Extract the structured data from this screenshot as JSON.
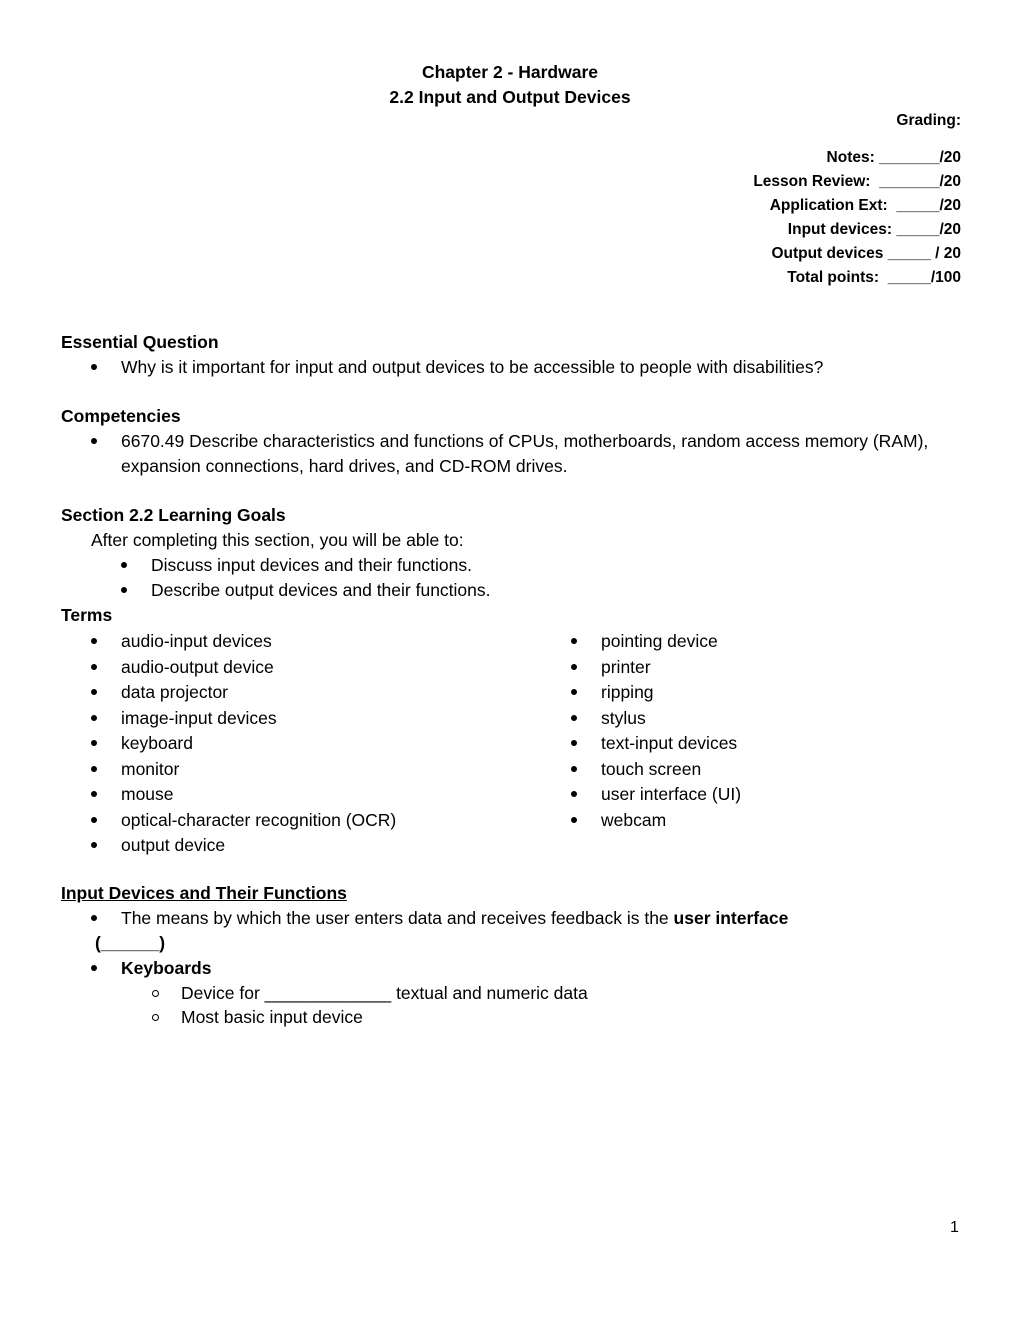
{
  "header": {
    "chapter_title": "Chapter 2 - Hardware",
    "section_title": "2.2 Input and Output Devices"
  },
  "grading": {
    "label": "Grading:",
    "rows": [
      {
        "label": "Notes:",
        "blank": "_______",
        "max": "/20"
      },
      {
        "label": "Lesson Review:",
        "blank": "_______",
        "max": "/20"
      },
      {
        "label": "Application Ext:",
        "blank": "_____",
        "max": "/20"
      },
      {
        "label": "Input devices:",
        "blank": "_____",
        "max": "/20"
      },
      {
        "label": "Output devices",
        "blank": "_____",
        "max": "/ 20"
      },
      {
        "label": "Total points:",
        "blank": "_____",
        "max": "/100"
      }
    ]
  },
  "essential_question": {
    "heading": "Essential Question",
    "items": [
      "Why is it important for input and output devices to be accessible to people with disabilities?"
    ]
  },
  "competencies": {
    "heading": "Competencies",
    "items": [
      {
        "line1": "6670.49 Describe characteristics and functions of CPUs, motherboards, random access memory (RAM),",
        "line2": "expansion connections, hard drives, and CD-ROM drives."
      }
    ]
  },
  "learning_goals": {
    "heading": "Section 2.2 Learning Goals",
    "intro": "After completing this section, you will be able to:",
    "items": [
      "Discuss input devices and their functions.",
      "Describe output devices and their functions."
    ]
  },
  "terms": {
    "heading": "Terms",
    "left": [
      "audio-input devices",
      "audio-output device",
      "data projector",
      "image-input devices",
      "keyboard",
      "monitor",
      "mouse",
      "optical-character recognition (OCR)",
      "output device"
    ],
    "right": [
      "pointing device",
      "printer",
      "ripping",
      "stylus",
      "text-input devices",
      "touch screen",
      "user interface (UI)",
      "webcam"
    ]
  },
  "input_devices": {
    "heading": "Input Devices and Their Functions",
    "ui_item": {
      "text": "The means by which the user enters data and receives feedback is the",
      "bold": "user interface",
      "blank_line": "(______)"
    },
    "keyboards": {
      "label": "Keyboards",
      "sub_items": [
        {
          "before": "Device for",
          "blank": "_____________",
          "after": "textual and numeric data"
        },
        {
          "text": "Most basic input device"
        }
      ]
    }
  },
  "footer": {
    "page_number": "1"
  }
}
